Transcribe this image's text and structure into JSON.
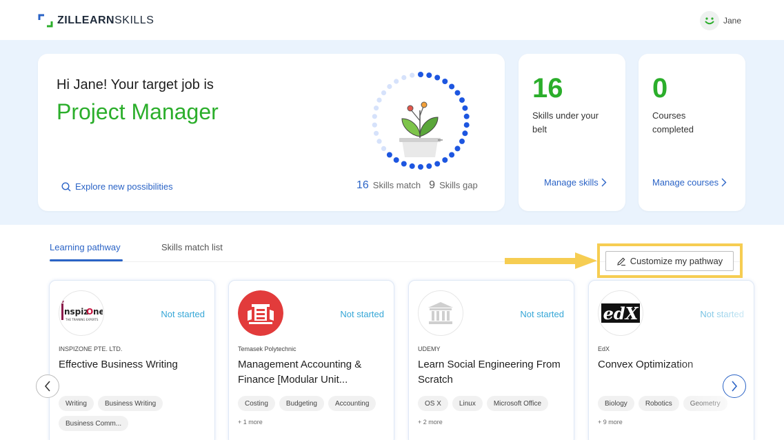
{
  "brand": {
    "name_bold": "ZILLEARN",
    "name_thin": "SKILLS",
    "accent": "#2bae2b",
    "blue": "#2a63c6"
  },
  "user": {
    "name": "Jane"
  },
  "hero": {
    "greeting": "Hi Jane! Your target job is",
    "job_title": "Project Manager",
    "explore_label": "Explore new possibilities",
    "skills_match_count": "16",
    "skills_match_label": "Skills match",
    "skills_gap_count": "9",
    "skills_gap_label": "Skills gap"
  },
  "stats": [
    {
      "value": "16",
      "label": "Skills under your belt",
      "link": "Manage skills"
    },
    {
      "value": "0",
      "label": "Courses completed",
      "link": "Manage courses"
    }
  ],
  "tabs": [
    {
      "label": "Learning pathway",
      "active": true
    },
    {
      "label": "Skills match list",
      "active": false
    }
  ],
  "customize_label": "Customize my pathway",
  "courses": [
    {
      "provider": "INSPIZONE PTE. LTD.",
      "title": "Effective Business Writing",
      "status": "Not started",
      "tags": [
        "Writing",
        "Business Writing",
        "Business Comm..."
      ],
      "more": ""
    },
    {
      "provider": "Temasek Polytechnic",
      "title": "Management Accounting & Finance [Modular Unit...",
      "status": "Not started",
      "tags": [
        "Costing",
        "Budgeting",
        "Accounting"
      ],
      "more": "+ 1 more"
    },
    {
      "provider": "UDEMY",
      "title": "Learn Social Engineering From Scratch",
      "status": "Not started",
      "tags": [
        "OS X",
        "Linux",
        "Microsoft Office"
      ],
      "more": "+ 2 more"
    },
    {
      "provider": "EdX",
      "title": "Convex Optimization",
      "status": "Not started",
      "tags": [
        "Biology",
        "Robotics",
        "Geometry"
      ],
      "more": "+ 9 more"
    }
  ],
  "logos": {
    "inspizone": "nspiz",
    "inspizone_o": "O",
    "inspizone_ne": "ne",
    "inspizone_sub": "THE TRAINING EXPERTS",
    "edx": "edX"
  }
}
